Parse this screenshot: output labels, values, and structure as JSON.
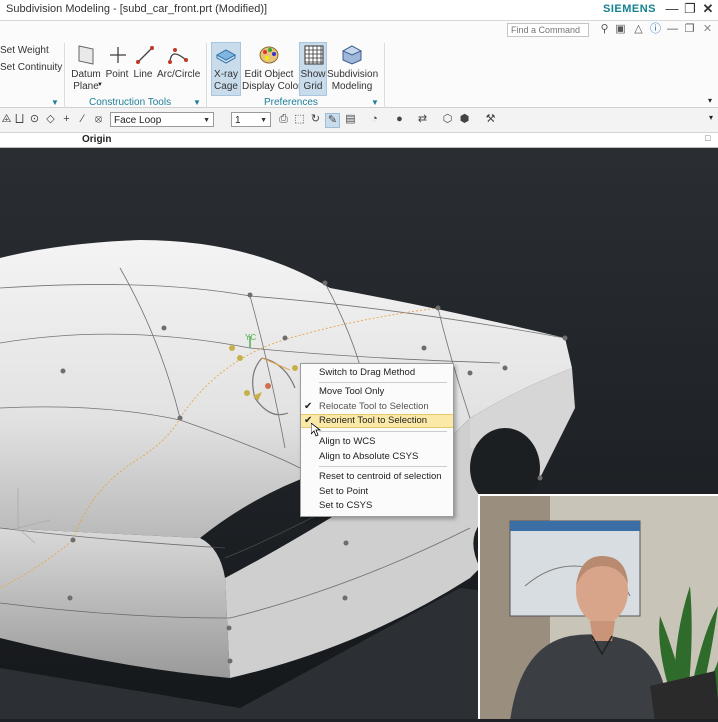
{
  "window": {
    "title": "Subdivision Modeling - [subd_car_front.prt (Modified)]",
    "brand": "SIEMENS",
    "buttons": [
      "minimize-icon",
      "restore-icon",
      "close-icon"
    ]
  },
  "ribbon": {
    "find_placeholder": "Find a Command",
    "left_items": [
      "Set Weight",
      "Set Continuity"
    ],
    "construction": {
      "buttons": [
        {
          "label": "Datum",
          "label2": "Plane",
          "icon": "datum-plane-icon"
        },
        {
          "label": "Point",
          "icon": "point-icon"
        },
        {
          "label": "Line",
          "icon": "line-icon"
        },
        {
          "label": "Arc/Circle",
          "icon": "arc-icon"
        }
      ],
      "group_label": "Construction Tools"
    },
    "preferences": {
      "buttons": [
        {
          "label": "X-ray",
          "label2": "Cage",
          "icon": "xray-cage-icon"
        },
        {
          "label": "Edit Object",
          "label2": "Display Color",
          "icon": "palette-icon"
        },
        {
          "label": "Show",
          "label2": "Grid",
          "icon": "grid-icon"
        },
        {
          "label": "Subdivision",
          "label2": "Modeling",
          "icon": "subdivision-icon"
        }
      ],
      "group_label": "Preferences"
    }
  },
  "toolbar": {
    "selection_filter": "Face Loop",
    "count": "1"
  },
  "origin_label": "Origin",
  "viewport": {
    "axis_label": "YC"
  },
  "context_menu": {
    "items": [
      {
        "label": "Switch to Drag Method",
        "checked": false
      },
      {
        "label": "Move Tool Only",
        "checked": false
      },
      {
        "label": "Relocate Tool to Selection",
        "checked": true
      },
      {
        "label": "Reorient Tool to Selection",
        "checked": true,
        "highlighted": true
      },
      {
        "label": "Align to WCS",
        "checked": false
      },
      {
        "label": "Align to Absolute CSYS",
        "checked": false
      },
      {
        "label": "Reset to centroid of selection",
        "checked": false
      },
      {
        "label": "Set to Point",
        "checked": false
      },
      {
        "label": "Set to CSYS",
        "checked": false
      }
    ]
  },
  "colors": {
    "brand": "#14838f",
    "accent": "#1d7e9a",
    "highlight": "#fbe9a7",
    "viewport_bg": "#1e2226"
  }
}
